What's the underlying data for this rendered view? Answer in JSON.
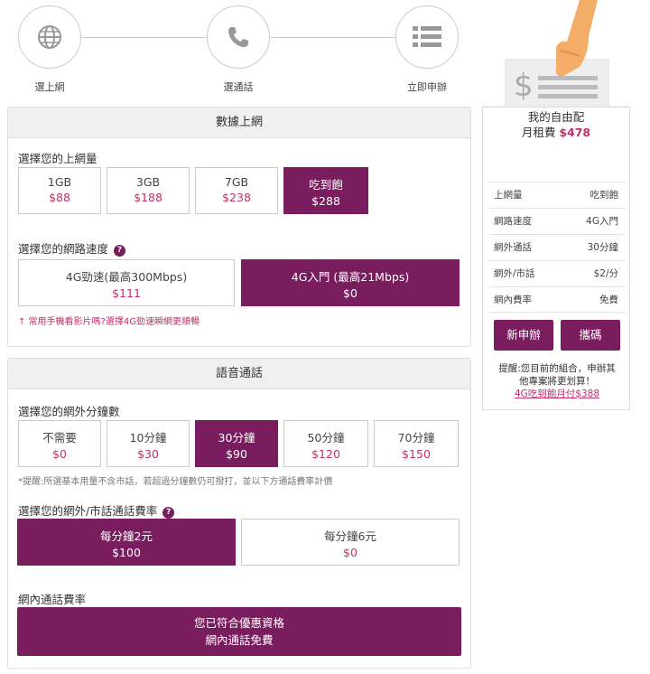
{
  "steps": [
    {
      "label": "選上網",
      "icon": "globe-icon"
    },
    {
      "label": "選通話",
      "icon": "phone-icon"
    },
    {
      "label": "立即申辦",
      "icon": "list-icon"
    }
  ],
  "data_panel": {
    "title": "數據上網",
    "volume_label": "選擇您的上網量",
    "volumes": [
      {
        "name": "1GB",
        "price": "$88",
        "selected": false
      },
      {
        "name": "3GB",
        "price": "$188",
        "selected": false
      },
      {
        "name": "7GB",
        "price": "$238",
        "selected": false
      },
      {
        "name": "吃到飽",
        "price": "$288",
        "selected": true
      }
    ],
    "speed_label": "選擇您的網路速度",
    "speeds": [
      {
        "name": "4G勁速(最高300Mbps)",
        "price": "$111",
        "selected": false
      },
      {
        "name": "4G入門 (最高21Mbps)",
        "price": "$0",
        "selected": true
      }
    ],
    "speed_hint": "↑ 常用手機看影片嗎?選擇4G勁速瞬網更順暢"
  },
  "voice_panel": {
    "title": "語音通話",
    "minutes_label": "選擇您的網外分鐘數",
    "minutes": [
      {
        "name": "不需要",
        "price": "$0",
        "selected": false
      },
      {
        "name": "10分鐘",
        "price": "$30",
        "selected": false
      },
      {
        "name": "30分鐘",
        "price": "$90",
        "selected": true
      },
      {
        "name": "50分鐘",
        "price": "$120",
        "selected": false
      },
      {
        "name": "70分鐘",
        "price": "$150",
        "selected": false
      }
    ],
    "minutes_hint": "*提醒:所選基本用量不含市話，若超過分鐘數仍可撥打，並以下方通話費率計價",
    "rate_label": "選擇您的網外/市話通話費率",
    "rates": [
      {
        "name": "每分鐘2元",
        "price": "$100",
        "selected": true
      },
      {
        "name": "每分鐘6元",
        "price": "$0",
        "selected": false
      }
    ],
    "onnet_label": "網內通話費率",
    "onnet_line1": "您已符合優惠資格",
    "onnet_line2": "網內通話免費"
  },
  "summary": {
    "plan_title": "我的自由配",
    "fee_label": "月租費",
    "fee_value": "$478",
    "rows": [
      {
        "k": "上網量",
        "v": "吃到飽"
      },
      {
        "k": "網路速度",
        "v": "4G入門"
      },
      {
        "k": "網外通話",
        "v": "30分鐘"
      },
      {
        "k": "網外/市話",
        "v": "$2/分"
      },
      {
        "k": "網內費率",
        "v": "免費"
      }
    ],
    "btn_new": "新申辦",
    "btn_port": "攜碼",
    "note_line1": "提醒:您目前的組合，申辦其",
    "note_line2": "他專案將更划算！",
    "note_link": "4G吃到飽月付$388"
  },
  "colors": {
    "accent": "#7a1d5e",
    "price": "#c0306b"
  }
}
